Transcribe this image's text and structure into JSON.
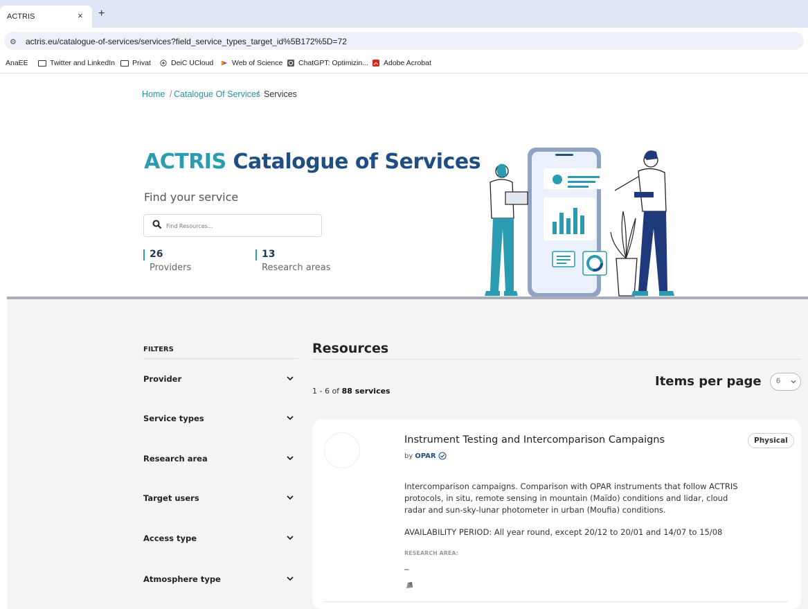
{
  "browser": {
    "tab_title": "ACTRIS",
    "tab_close": "×",
    "new_tab": "+",
    "url": "actris.eu/catalogue-of-services/services?field_service_types_target_id%5B172%5D=72",
    "bookmarks": [
      {
        "label": "AnaEE",
        "icon": "none"
      },
      {
        "label": "Twitter and LinkedIn",
        "icon": "folder-icon"
      },
      {
        "label": "Privat",
        "icon": "folder-icon"
      },
      {
        "label": "DeiC UCloud",
        "icon": "cloud-icon"
      },
      {
        "label": "Web of Science",
        "icon": "wos-icon"
      },
      {
        "label": "ChatGPT: Optimizin...",
        "icon": "chatgpt-icon"
      },
      {
        "label": "Adobe Acrobat",
        "icon": "acrobat-icon"
      }
    ]
  },
  "breadcrumb": {
    "home": "Home",
    "sep1": "/",
    "catalogue": "Catalogue Of Services",
    "sep2": "/",
    "current": "Services"
  },
  "hero": {
    "title_part1": "ACTRIS",
    "title_part2": "Catalogue of Services",
    "subtitle": "Find your service",
    "search_placeholder": "Find Resources..."
  },
  "stats": [
    {
      "value": "26",
      "label": "Providers"
    },
    {
      "value": "13",
      "label": "Research areas"
    }
  ],
  "filters": {
    "title": "FILTERS",
    "items": [
      "Provider",
      "Service types",
      "Research area",
      "Target users",
      "Access type",
      "Atmosphere type"
    ]
  },
  "resources": {
    "title": "Resources",
    "count_prefix": "1 - 6 of",
    "count_bold": "88 services",
    "items_per_page_label": "Items per page",
    "items_per_page_value": "6"
  },
  "card": {
    "title": "Instrument Testing and Intercomparison Campaigns",
    "by_prefix": "by",
    "provider": "OPAR",
    "badge": "Physical",
    "description": "Intercomparison campaigns. Comparison with OPAR instruments that follow ACTRIS protocols, in situ, remote sensing in mountain (Maïdo) conditions and lidar, cloud radar and sun-sky-lunar photometer in urban (Moufia) conditions.",
    "availability": "AVAILABILITY PERIOD: All year round, except 20/12 to 20/01 and 14/07 to 15/08",
    "research_area_label": "RESEARCH AREA:",
    "research_area_value": "–"
  },
  "colors": {
    "accent_teal": "#2a9bb0",
    "accent_navy": "#1f4f82",
    "tabbar": "#dfe6f5",
    "lower_bg": "#f4f4f6"
  }
}
